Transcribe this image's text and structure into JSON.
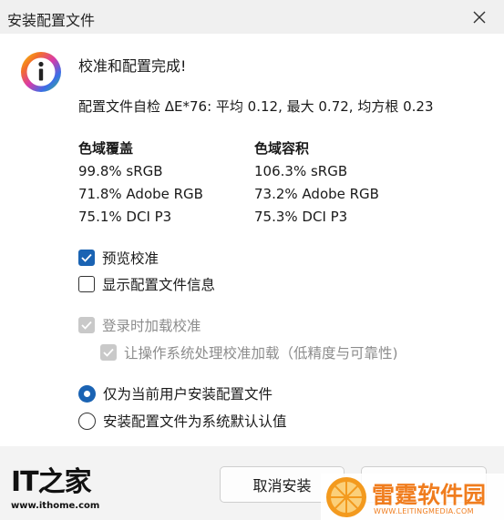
{
  "window": {
    "title": "安装配置文件"
  },
  "dialog": {
    "headline": "校准和配置完成!",
    "self_check": "配置文件自检 ΔE*76: 平均 0.12, 最大 0.72, 均方根 0.23"
  },
  "gamut_coverage": {
    "heading": "色域覆盖",
    "rows": [
      "99.8% sRGB",
      "71.8% Adobe RGB",
      "75.1% DCI P3"
    ]
  },
  "gamut_volume": {
    "heading": "色域容积",
    "rows": [
      "106.3% sRGB",
      "73.2% Adobe RGB",
      "75.3% DCI P3"
    ]
  },
  "options": {
    "preview_calibration": {
      "label": "预览校准",
      "checked": true
    },
    "show_profile_info": {
      "label": "显示配置文件信息",
      "checked": false
    },
    "load_on_login": {
      "label": "登录时加载校准",
      "checked": true,
      "disabled": true
    },
    "os_handles_loading": {
      "label": "让操作系统处理校准加载（低精度与可靠性)",
      "checked": true,
      "disabled": true
    }
  },
  "install_scope": {
    "current_user": {
      "label": "仅为当前用户安装配置文件",
      "selected": true
    },
    "system_default": {
      "label": "安装配置文件为系统默认认值",
      "selected": false
    }
  },
  "buttons": {
    "cancel": "取消安装"
  },
  "watermarks": {
    "ithome_logo": "IT之家",
    "ithome_url": "www.ithome.com",
    "leiting_name": "雷霆软件园",
    "leiting_domain": "WWW.LEITINGMEDIA.COM"
  },
  "colors": {
    "accent": "#1a63b3",
    "disabled": "#c9c9c9",
    "watermark_orange": "#f07d1e"
  }
}
